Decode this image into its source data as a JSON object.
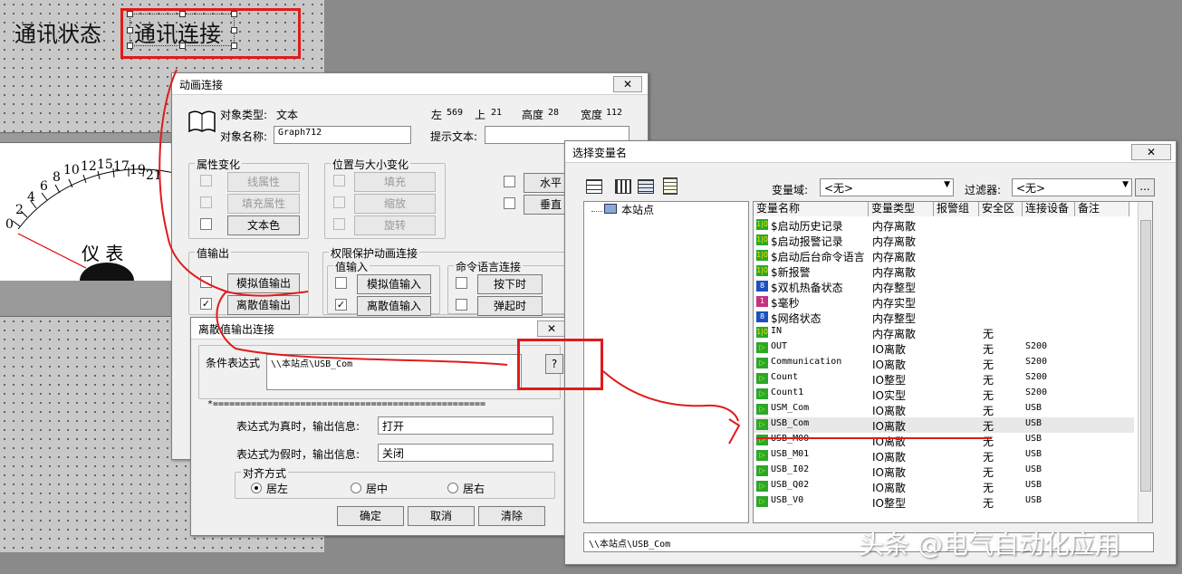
{
  "canvas": {
    "text1": "通讯状态",
    "text2": "通讯连接"
  },
  "gauge": {
    "ticks": [
      "0",
      "2",
      "4",
      "6",
      "8",
      "10",
      "12",
      "15",
      "17",
      "19",
      "21"
    ],
    "label": "仪 表"
  },
  "anim_dialog": {
    "title": "动画连接",
    "close": "✕",
    "obj_type_label": "对象类型:",
    "obj_type": "文本",
    "left_label": "左",
    "left": "569",
    "top_label": "上",
    "top": "21",
    "height_label": "高度",
    "height": "28",
    "width_label": "宽度",
    "width": "112",
    "obj_name_label": "对象名称:",
    "obj_name": "Graph712",
    "tip_label": "提示文本:",
    "tip_value": "",
    "attr_group": "属性变化",
    "attr_btns": [
      "线属性",
      "填充属性",
      "文本色"
    ],
    "pos_group": "位置与大小变化",
    "pos_btns": [
      "填充",
      "缩放",
      "旋转"
    ],
    "hv_btns": [
      "水平",
      "垂直"
    ],
    "val_out_group": "值输出",
    "val_out_btns": [
      "模拟值输出",
      "离散值输出"
    ],
    "perm_group": "权限保护动画连接",
    "val_in_group": "值输入",
    "val_in_btns": [
      "模拟值输入",
      "离散值输入"
    ],
    "cmd_group": "命令语言连接",
    "cmd_btns": [
      "按下时",
      "弹起时"
    ]
  },
  "discrete_dialog": {
    "title": "离散值输出连接",
    "close": "✕",
    "cond_label": "条件表达式",
    "cond_value": "\\\\本站点\\USB_Com",
    "q_btn": "?",
    "divider": "*==================================================",
    "true_label": "表达式为真时，输出信息:",
    "true_value": "打开",
    "false_label": "表达式为假时，输出信息:",
    "false_value": "关闭",
    "align_group": "对齐方式",
    "align_opts": [
      "居左",
      "居中",
      "居右"
    ],
    "ok": "确定",
    "cancel": "取消",
    "clear": "清除"
  },
  "var_dialog": {
    "title": "选择变量名",
    "close": "✕",
    "domain_label": "变量域:",
    "domain_value": "<无>",
    "filter_label": "过滤器:",
    "filter_value": "<无>",
    "browse": "...",
    "tree_root": "本站点",
    "columns": [
      "变量名称",
      "变量类型",
      "报警组",
      "安全区",
      "连接设备",
      "备注"
    ],
    "rows": [
      {
        "icon": "1|0",
        "name": "$启动历史记录",
        "type": "内存离散",
        "sec": "",
        "dev": ""
      },
      {
        "icon": "1|0",
        "name": "$启动报警记录",
        "type": "内存离散",
        "sec": "",
        "dev": ""
      },
      {
        "icon": "1|0",
        "name": "$启动后台命令语言",
        "type": "内存离散",
        "sec": "",
        "dev": ""
      },
      {
        "icon": "1|0",
        "name": "$新报警",
        "type": "内存离散",
        "sec": "",
        "dev": ""
      },
      {
        "icon": "8",
        "name": "$双机热备状态",
        "type": "内存整型",
        "sec": "",
        "dev": ""
      },
      {
        "icon": "1",
        "name": "$毫秒",
        "type": "内存实型",
        "sec": "",
        "dev": ""
      },
      {
        "icon": "8",
        "name": "$网络状态",
        "type": "内存整型",
        "sec": "",
        "dev": ""
      },
      {
        "icon": "1|0",
        "name": "IN",
        "type": "内存离散",
        "sec": "无",
        "dev": ""
      },
      {
        "icon": "io",
        "name": "OUT",
        "type": "IO离散",
        "sec": "无",
        "dev": "S200"
      },
      {
        "icon": "io",
        "name": "Communication",
        "type": "IO离散",
        "sec": "无",
        "dev": "S200"
      },
      {
        "icon": "io",
        "name": "Count",
        "type": "IO整型",
        "sec": "无",
        "dev": "S200"
      },
      {
        "icon": "io",
        "name": "Count1",
        "type": "IO实型",
        "sec": "无",
        "dev": "S200"
      },
      {
        "icon": "io",
        "name": "USM_Com",
        "type": "IO离散",
        "sec": "无",
        "dev": "USB"
      },
      {
        "icon": "io",
        "name": "USB_Com",
        "type": "IO离散",
        "sec": "无",
        "dev": "USB"
      },
      {
        "icon": "io",
        "name": "USB_M00",
        "type": "IO离散",
        "sec": "无",
        "dev": "USB"
      },
      {
        "icon": "io",
        "name": "USB_M01",
        "type": "IO离散",
        "sec": "无",
        "dev": "USB"
      },
      {
        "icon": "io",
        "name": "USB_I02",
        "type": "IO离散",
        "sec": "无",
        "dev": "USB"
      },
      {
        "icon": "io",
        "name": "USB_Q02",
        "type": "IO离散",
        "sec": "无",
        "dev": "USB"
      },
      {
        "icon": "io",
        "name": "USB_V0",
        "type": "IO整型",
        "sec": "无",
        "dev": "USB"
      }
    ],
    "status_path": "\\\\本站点\\USB_Com"
  },
  "watermark": "头条 @电气自动化应用",
  "colors": {
    "annotation_red": "#e01b1b",
    "selected_row": "#e8e8e8"
  }
}
